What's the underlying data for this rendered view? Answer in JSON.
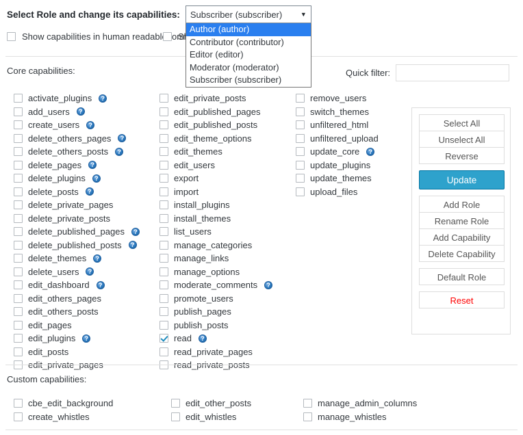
{
  "role_selector": {
    "label": "Select Role and change its capabilities:",
    "selected": "Subscriber (subscriber)",
    "caret": "▼",
    "options": [
      {
        "label": "Author (author)",
        "selected": true
      },
      {
        "label": "Contributor (contributor)",
        "selected": false
      },
      {
        "label": "Editor (editor)",
        "selected": false
      },
      {
        "label": "Moderator (moderator)",
        "selected": false
      },
      {
        "label": "Subscriber (subscriber)",
        "selected": false
      }
    ]
  },
  "options_row": {
    "human_readable_label": "Show capabilities in human readable form",
    "human_readable_checked": false,
    "deprecated_label": "Show deprecated capabilities",
    "deprecated_checked": false
  },
  "sections": {
    "core_title": "Core capabilities:",
    "custom_title": "Custom capabilities:"
  },
  "quick_filter": {
    "label": "Quick filter:",
    "value": "",
    "placeholder": ""
  },
  "core_capabilities": [
    [
      {
        "name": "activate_plugins",
        "checked": false,
        "help": true
      },
      {
        "name": "add_users",
        "checked": false,
        "help": true
      },
      {
        "name": "create_users",
        "checked": false,
        "help": true
      },
      {
        "name": "delete_others_pages",
        "checked": false,
        "help": true
      },
      {
        "name": "delete_others_posts",
        "checked": false,
        "help": true
      },
      {
        "name": "delete_pages",
        "checked": false,
        "help": true
      },
      {
        "name": "delete_plugins",
        "checked": false,
        "help": true
      },
      {
        "name": "delete_posts",
        "checked": false,
        "help": true
      },
      {
        "name": "delete_private_pages",
        "checked": false,
        "help": false
      },
      {
        "name": "delete_private_posts",
        "checked": false,
        "help": false
      },
      {
        "name": "delete_published_pages",
        "checked": false,
        "help": true
      },
      {
        "name": "delete_published_posts",
        "checked": false,
        "help": true
      },
      {
        "name": "delete_themes",
        "checked": false,
        "help": true
      },
      {
        "name": "delete_users",
        "checked": false,
        "help": true
      },
      {
        "name": "edit_dashboard",
        "checked": false,
        "help": true
      },
      {
        "name": "edit_others_pages",
        "checked": false,
        "help": false
      },
      {
        "name": "edit_others_posts",
        "checked": false,
        "help": false
      },
      {
        "name": "edit_pages",
        "checked": false,
        "help": false
      },
      {
        "name": "edit_plugins",
        "checked": false,
        "help": true
      },
      {
        "name": "edit_posts",
        "checked": false,
        "help": false
      },
      {
        "name": "edit_private_pages",
        "checked": false,
        "help": false
      }
    ],
    [
      {
        "name": "edit_private_posts",
        "checked": false,
        "help": false
      },
      {
        "name": "edit_published_pages",
        "checked": false,
        "help": false
      },
      {
        "name": "edit_published_posts",
        "checked": false,
        "help": false
      },
      {
        "name": "edit_theme_options",
        "checked": false,
        "help": false
      },
      {
        "name": "edit_themes",
        "checked": false,
        "help": false
      },
      {
        "name": "edit_users",
        "checked": false,
        "help": false
      },
      {
        "name": "export",
        "checked": false,
        "help": false
      },
      {
        "name": "import",
        "checked": false,
        "help": false
      },
      {
        "name": "install_plugins",
        "checked": false,
        "help": false
      },
      {
        "name": "install_themes",
        "checked": false,
        "help": false
      },
      {
        "name": "list_users",
        "checked": false,
        "help": false
      },
      {
        "name": "manage_categories",
        "checked": false,
        "help": false
      },
      {
        "name": "manage_links",
        "checked": false,
        "help": false
      },
      {
        "name": "manage_options",
        "checked": false,
        "help": false
      },
      {
        "name": "moderate_comments",
        "checked": false,
        "help": true
      },
      {
        "name": "promote_users",
        "checked": false,
        "help": false
      },
      {
        "name": "publish_pages",
        "checked": false,
        "help": false
      },
      {
        "name": "publish_posts",
        "checked": false,
        "help": false
      },
      {
        "name": "read",
        "checked": true,
        "help": true
      },
      {
        "name": "read_private_pages",
        "checked": false,
        "help": false
      },
      {
        "name": "read_private_posts",
        "checked": false,
        "help": false
      }
    ],
    [
      {
        "name": "remove_users",
        "checked": false,
        "help": false
      },
      {
        "name": "switch_themes",
        "checked": false,
        "help": false
      },
      {
        "name": "unfiltered_html",
        "checked": false,
        "help": false
      },
      {
        "name": "unfiltered_upload",
        "checked": false,
        "help": false
      },
      {
        "name": "update_core",
        "checked": false,
        "help": true
      },
      {
        "name": "update_plugins",
        "checked": false,
        "help": false
      },
      {
        "name": "update_themes",
        "checked": false,
        "help": false
      },
      {
        "name": "upload_files",
        "checked": false,
        "help": false
      }
    ]
  ],
  "custom_capabilities": [
    [
      {
        "name": "cbe_edit_background",
        "checked": false
      },
      {
        "name": "create_whistles",
        "checked": false
      }
    ],
    [
      {
        "name": "edit_other_posts",
        "checked": false
      },
      {
        "name": "edit_whistles",
        "checked": false
      }
    ],
    [
      {
        "name": "manage_admin_columns",
        "checked": false
      },
      {
        "name": "manage_whistles",
        "checked": false
      }
    ]
  ],
  "action_panel": {
    "groups": [
      {
        "buttons": [
          {
            "label": "Select All",
            "style": "default"
          },
          {
            "label": "Unselect All",
            "style": "default"
          },
          {
            "label": "Reverse",
            "style": "default"
          }
        ]
      },
      {
        "buttons": [
          {
            "label": "Update",
            "style": "primary"
          }
        ]
      },
      {
        "buttons": [
          {
            "label": "Add Role",
            "style": "default"
          },
          {
            "label": "Rename Role",
            "style": "default"
          },
          {
            "label": "Add Capability",
            "style": "default"
          },
          {
            "label": "Delete Capability",
            "style": "default"
          }
        ]
      },
      {
        "buttons": [
          {
            "label": "Default Role",
            "style": "default"
          }
        ]
      },
      {
        "buttons": [
          {
            "label": "Reset",
            "style": "danger"
          }
        ]
      }
    ]
  },
  "icons": {
    "help": "?",
    "check": "✓"
  },
  "colors": {
    "primary": "#2ea2cc",
    "primary_border": "#0074a2",
    "danger": "#ff0000",
    "option_highlight": "#2a7fef",
    "help_icon": "#2b7ac0",
    "text": "#32373c",
    "border": "#ddd"
  }
}
